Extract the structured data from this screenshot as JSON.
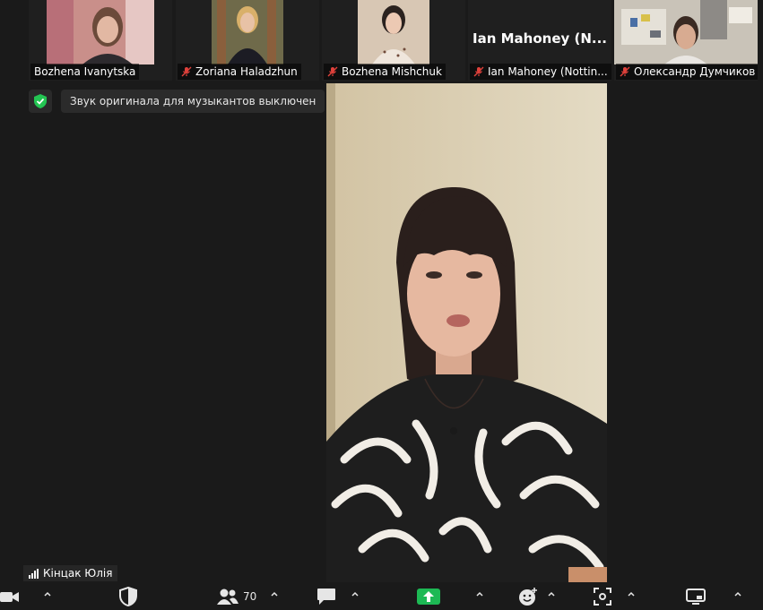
{
  "participants": [
    {
      "name": "Bozhena Ivanytska",
      "muted": false
    },
    {
      "name": "Zoriana Haladzhun",
      "muted": true
    },
    {
      "name": "Bozhena Mishchuk",
      "muted": true
    },
    {
      "name": "Ian Mahoney (Nottin...",
      "muted": true,
      "video_off_label": "Ian Mahoney (N..."
    },
    {
      "name": "Олександр Думчиков",
      "muted": true
    }
  ],
  "notice": {
    "text": "Звук оригинала для музыкантов выключен"
  },
  "active_speaker": {
    "name": "Кінцак Юлія"
  },
  "toolbar": {
    "participants_count": "70"
  },
  "colors": {
    "background": "#1a1a1a",
    "share_green": "#1db954",
    "shield_green": "#23c552",
    "muted_red": "#e0413b"
  }
}
